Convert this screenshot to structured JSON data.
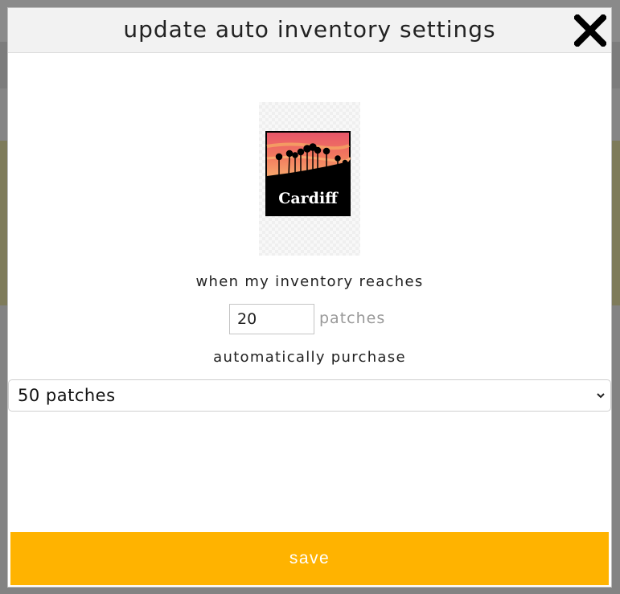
{
  "modal": {
    "title": "update auto inventory settings",
    "patch_image": {
      "text": "Cardiff"
    },
    "threshold_prompt": "when my inventory reaches",
    "threshold_value": "20",
    "threshold_unit": "patches",
    "purchase_prompt": "automatically purchase",
    "purchase_selected": "50 patches",
    "save_label": "save"
  },
  "colors": {
    "accent": "#ffb300",
    "header_bg": "#f2f2f2"
  }
}
